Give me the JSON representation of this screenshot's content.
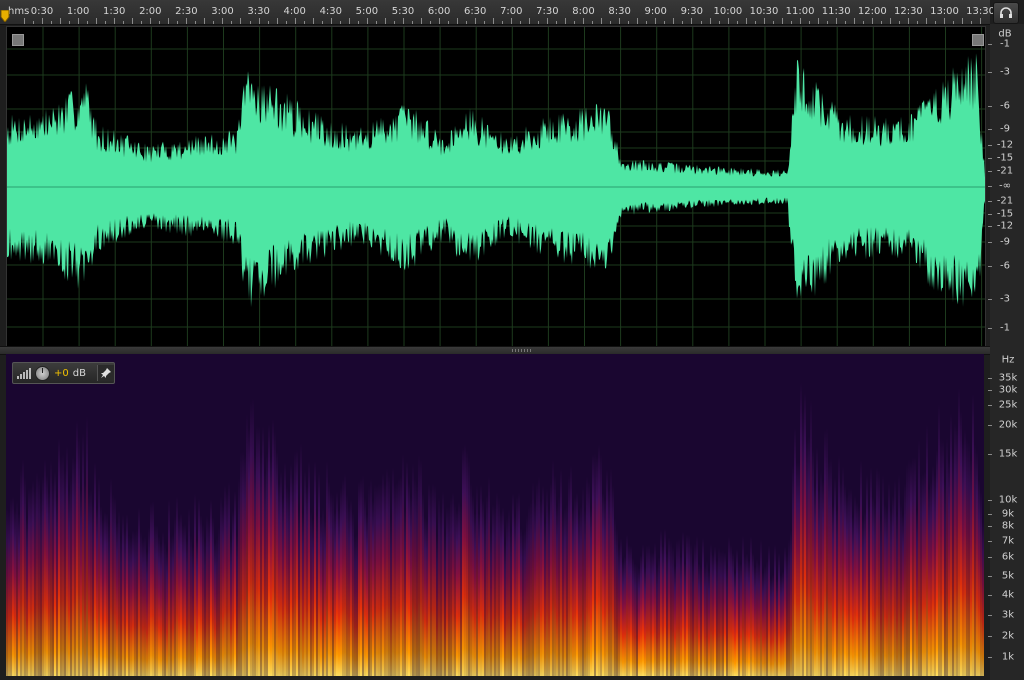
{
  "ruler": {
    "unit_label": "hms",
    "time_labels": [
      "0:30",
      "1:00",
      "1:30",
      "2:00",
      "2:30",
      "3:00",
      "3:30",
      "4:00",
      "4:30",
      "5:00",
      "5:30",
      "6:00",
      "6:30",
      "7:00",
      "7:30",
      "8:00",
      "8:30",
      "9:00",
      "9:30",
      "10:00",
      "10:30",
      "11:00",
      "11:30",
      "12:00",
      "12:30",
      "13:00",
      "13:30"
    ]
  },
  "waveform": {
    "scale_unit": "dB",
    "scale_labels": [
      "-1",
      "-3",
      "-6",
      "-9",
      "-12",
      "-15",
      "-21",
      "-∞",
      "-21",
      "-15",
      "-12",
      "-9",
      "-6",
      "-3",
      "-1"
    ],
    "color": "#4ee6a4",
    "grid_color": "#1d3a1d"
  },
  "spectrogram": {
    "scale_unit": "Hz",
    "scale_labels": [
      "35k",
      "30k",
      "25k",
      "20k",
      "15k",
      "10k",
      "9k",
      "8k",
      "7k",
      "6k",
      "5k",
      "4k",
      "3k",
      "2k",
      "1k"
    ]
  },
  "gain_hud": {
    "value": "+0",
    "unit": "dB"
  },
  "icons": {
    "corner": "headphones-icon",
    "hud_meter": "level-meter-icon",
    "hud_knob": "gain-knob-icon",
    "hud_pin": "pin-icon"
  }
}
